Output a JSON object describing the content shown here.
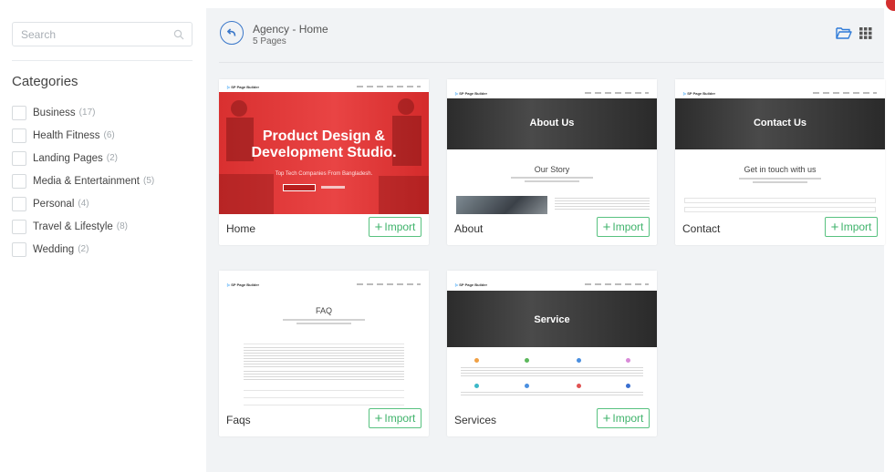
{
  "search": {
    "placeholder": "Search"
  },
  "sidebar": {
    "categories_title": "Categories",
    "categories": [
      {
        "label": "Business",
        "count": "(17)"
      },
      {
        "label": "Health Fitness",
        "count": "(6)"
      },
      {
        "label": "Landing Pages",
        "count": "(2)"
      },
      {
        "label": "Media & Entertainment",
        "count": "(5)"
      },
      {
        "label": "Personal",
        "count": "(4)"
      },
      {
        "label": "Travel & Lifestyle",
        "count": "(8)"
      },
      {
        "label": "Wedding",
        "count": "(2)"
      }
    ]
  },
  "header": {
    "title": "Agency - Home",
    "subtitle": "5 Pages"
  },
  "import_label": "Import",
  "cards": [
    {
      "name": "Home"
    },
    {
      "name": "About"
    },
    {
      "name": "Contact"
    },
    {
      "name": "Faqs"
    },
    {
      "name": "Services"
    }
  ],
  "thumbs": {
    "logo": "SP Page Builder",
    "home_headline_1": "Product Design &",
    "home_headline_2": "Development Studio.",
    "home_sub": "Top Tech Companies From Bangladesh.",
    "about_banner": "About Us",
    "about_section": "Our Story",
    "contact_banner": "Contact Us",
    "contact_section": "Get in touch with us",
    "faq_section": "FAQ",
    "service_banner": "Service"
  },
  "colors": {
    "accent": "#3a77c9",
    "import_green": "#3fb36b",
    "hero_red": "#e23b3b",
    "notification": "#d32f2f"
  }
}
